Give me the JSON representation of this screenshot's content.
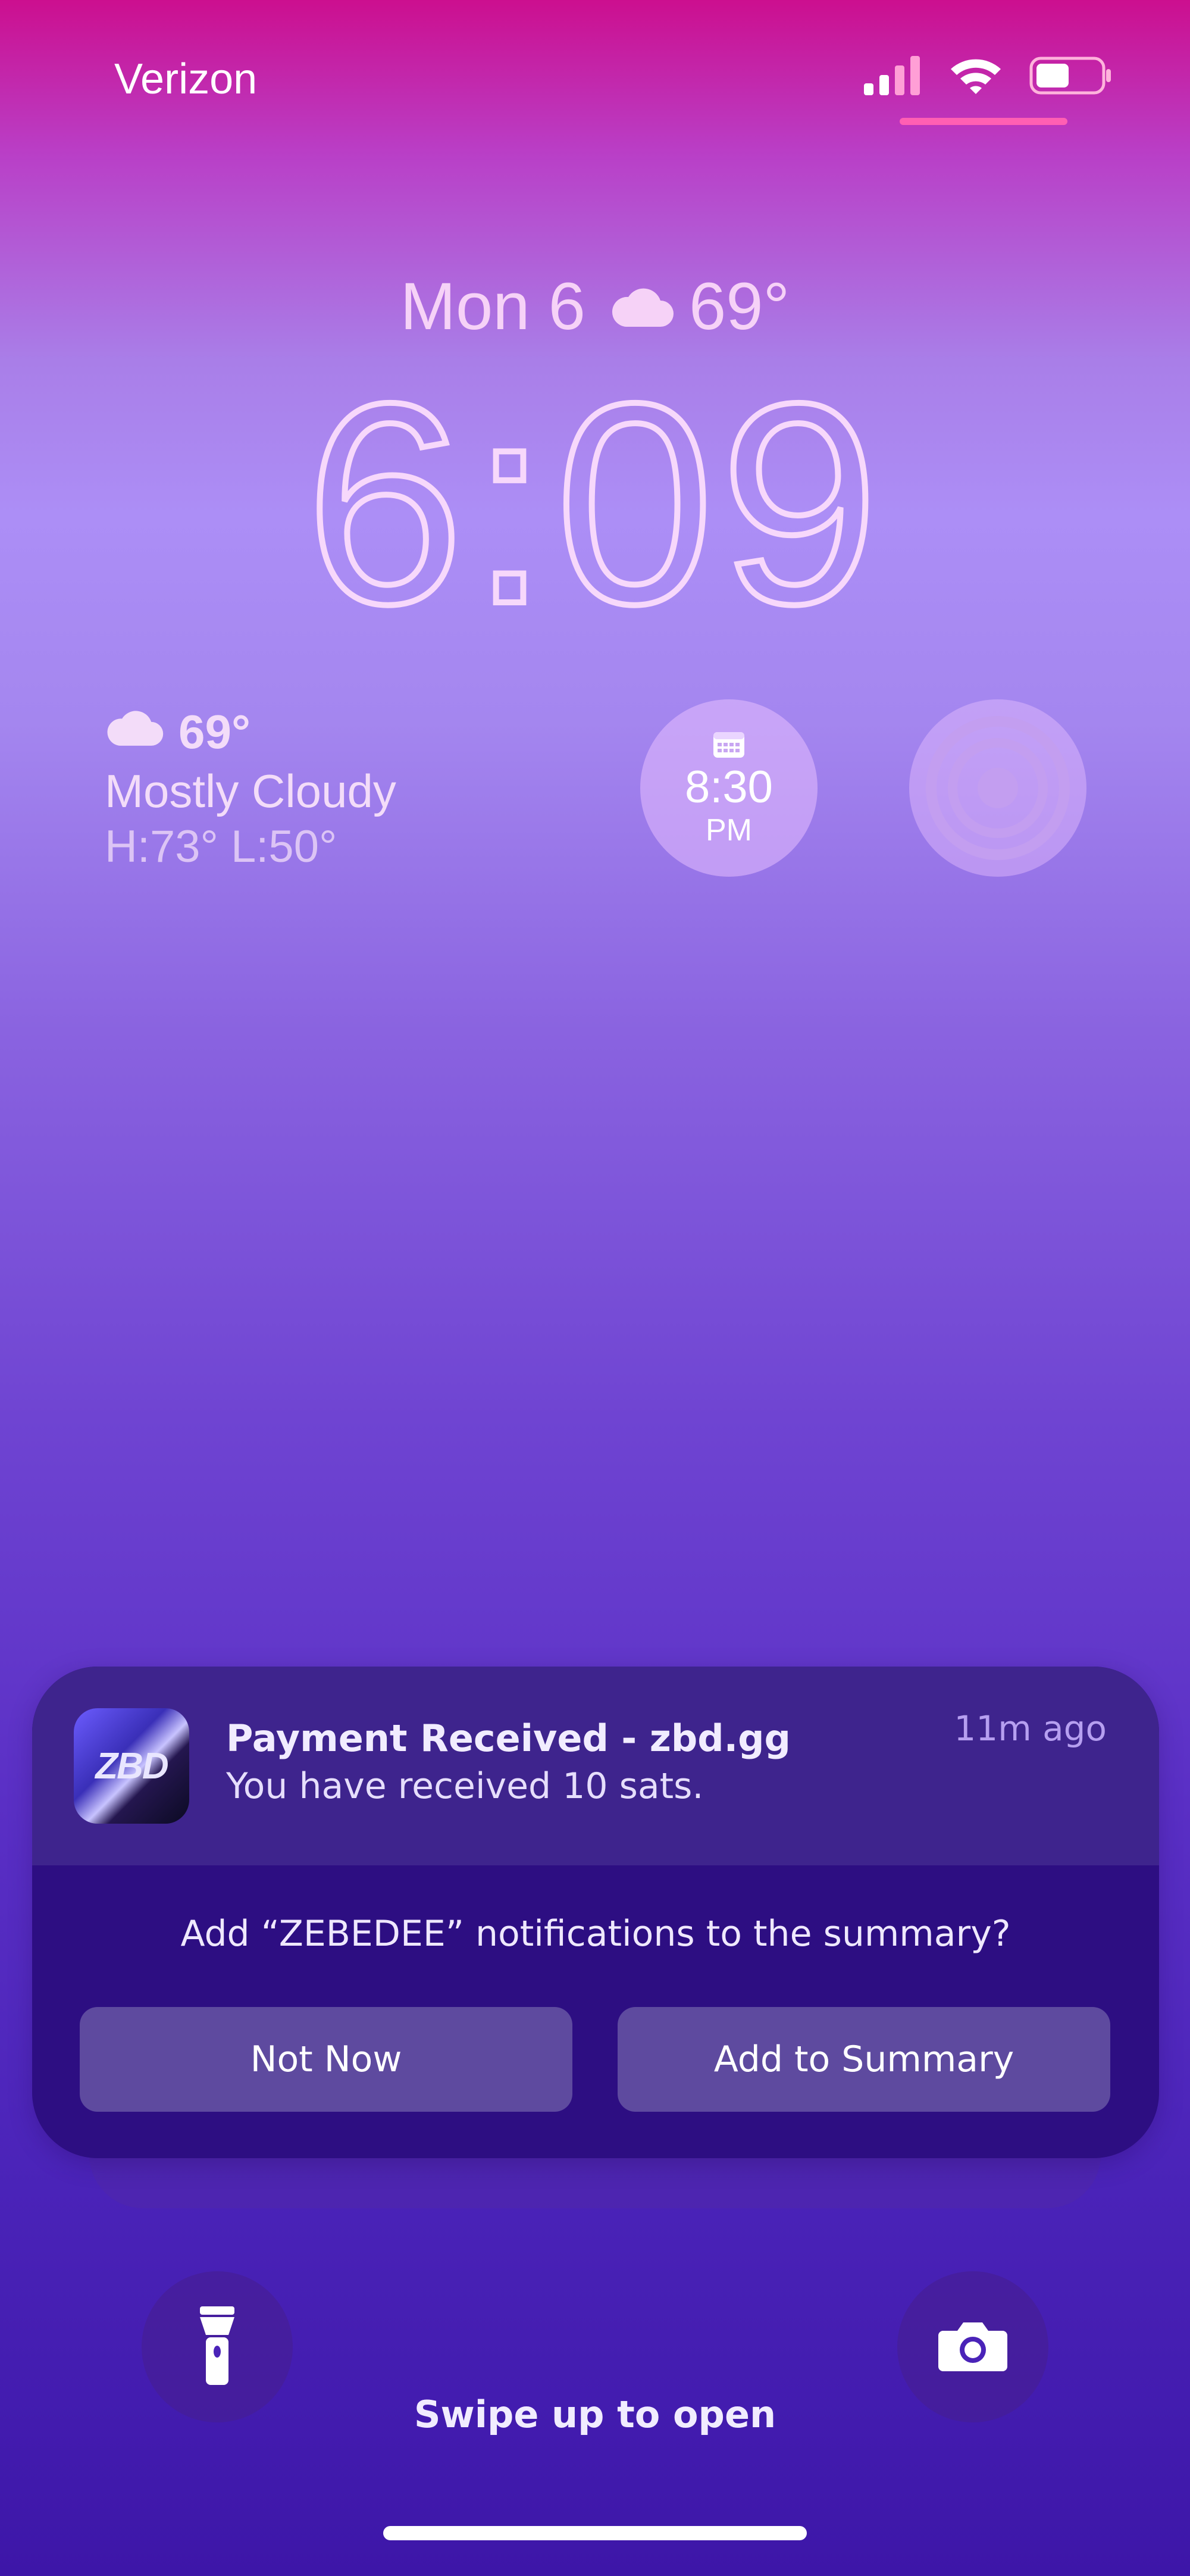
{
  "status_bar": {
    "carrier": "Verizon",
    "icons": [
      "cellular-signal-icon",
      "wifi-icon",
      "battery-icon"
    ]
  },
  "lock_screen": {
    "date": "Mon 6",
    "date_temp": "69°",
    "time": "6:09"
  },
  "widgets": {
    "weather": {
      "temp": "69°",
      "condition": "Mostly Cloudy",
      "high_low": "H:73° L:50°"
    },
    "alarm": {
      "time": "8:30",
      "ampm": "PM"
    },
    "target": {
      "icon": "target-rings-icon"
    }
  },
  "notification": {
    "app_icon_text": "ZBD",
    "title": "Payment Received - zbd.gg",
    "body": "You have received 10 sats.",
    "time": "11m ago",
    "question": "Add “ZEBEDEE” notifications to the summary?",
    "buttons": {
      "not_now": "Not Now",
      "add_to_summary": "Add to Summary"
    }
  },
  "bottom": {
    "swipe_hint": "Swipe up to open",
    "left_button_icon": "flashlight-icon",
    "right_button_icon": "camera-icon"
  },
  "colors": {
    "gradient_top": "#cc0f8f",
    "gradient_mid": "#ac8ef6",
    "gradient_bottom": "#3d16a8",
    "notification_bg": "#2d0e82",
    "notification_header_bg": "#3e248d",
    "button_bg": "#5e4a9f",
    "accent_pink": "#ff5fb3"
  }
}
